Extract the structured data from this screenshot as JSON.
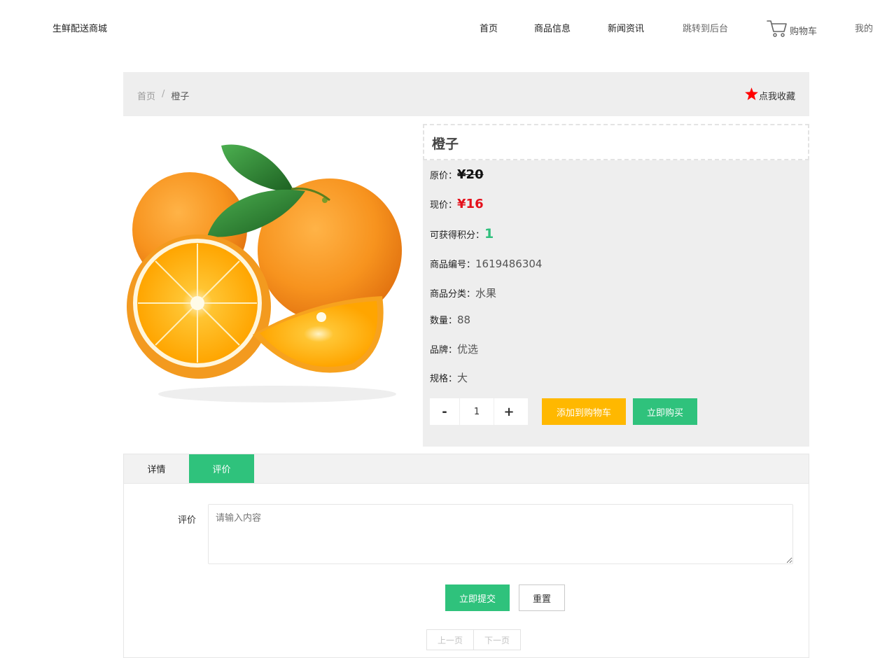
{
  "header": {
    "brand": "生鲜配送商城",
    "nav": [
      "首页",
      "商品信息",
      "新闻资讯",
      "跳转到后台"
    ],
    "cart_label": "购物车",
    "mine_label": "我的"
  },
  "breadcrumb": {
    "home": "首页",
    "separator": "/",
    "current": "橙子",
    "favorite_label": "点我收藏"
  },
  "product": {
    "name": "橙子",
    "image_icon": "orange-fruit-photo",
    "original_price_label": "原价：",
    "original_price": "¥20",
    "current_price_label": "现价：",
    "current_price": "¥16",
    "points_label": "可获得积分：",
    "points": "1",
    "code_label": "商品编号：",
    "code": "1619486304",
    "category_label": "商品分类：",
    "category": "水果",
    "stock_label": "数量：",
    "stock": "88",
    "brand_label": "品牌：",
    "brand": "优选",
    "spec_label": "规格：",
    "spec": "大"
  },
  "purchase": {
    "minus": "-",
    "quantity": "1",
    "plus": "+",
    "add_to_cart": "添加到购物车",
    "buy_now": "立即购买"
  },
  "tabs": {
    "items": [
      {
        "label": "详情",
        "active": false
      },
      {
        "label": "评价",
        "active": true
      }
    ]
  },
  "review": {
    "label": "评价",
    "placeholder": "请输入内容",
    "submit": "立即提交",
    "reset": "重置"
  },
  "pager": {
    "prev": "上一页",
    "next": "下一页"
  },
  "colors": {
    "accent_green": "#2fc27c",
    "accent_yellow": "#ffb800",
    "price_red": "#e4101b",
    "panel_gray": "#eeeeee"
  }
}
